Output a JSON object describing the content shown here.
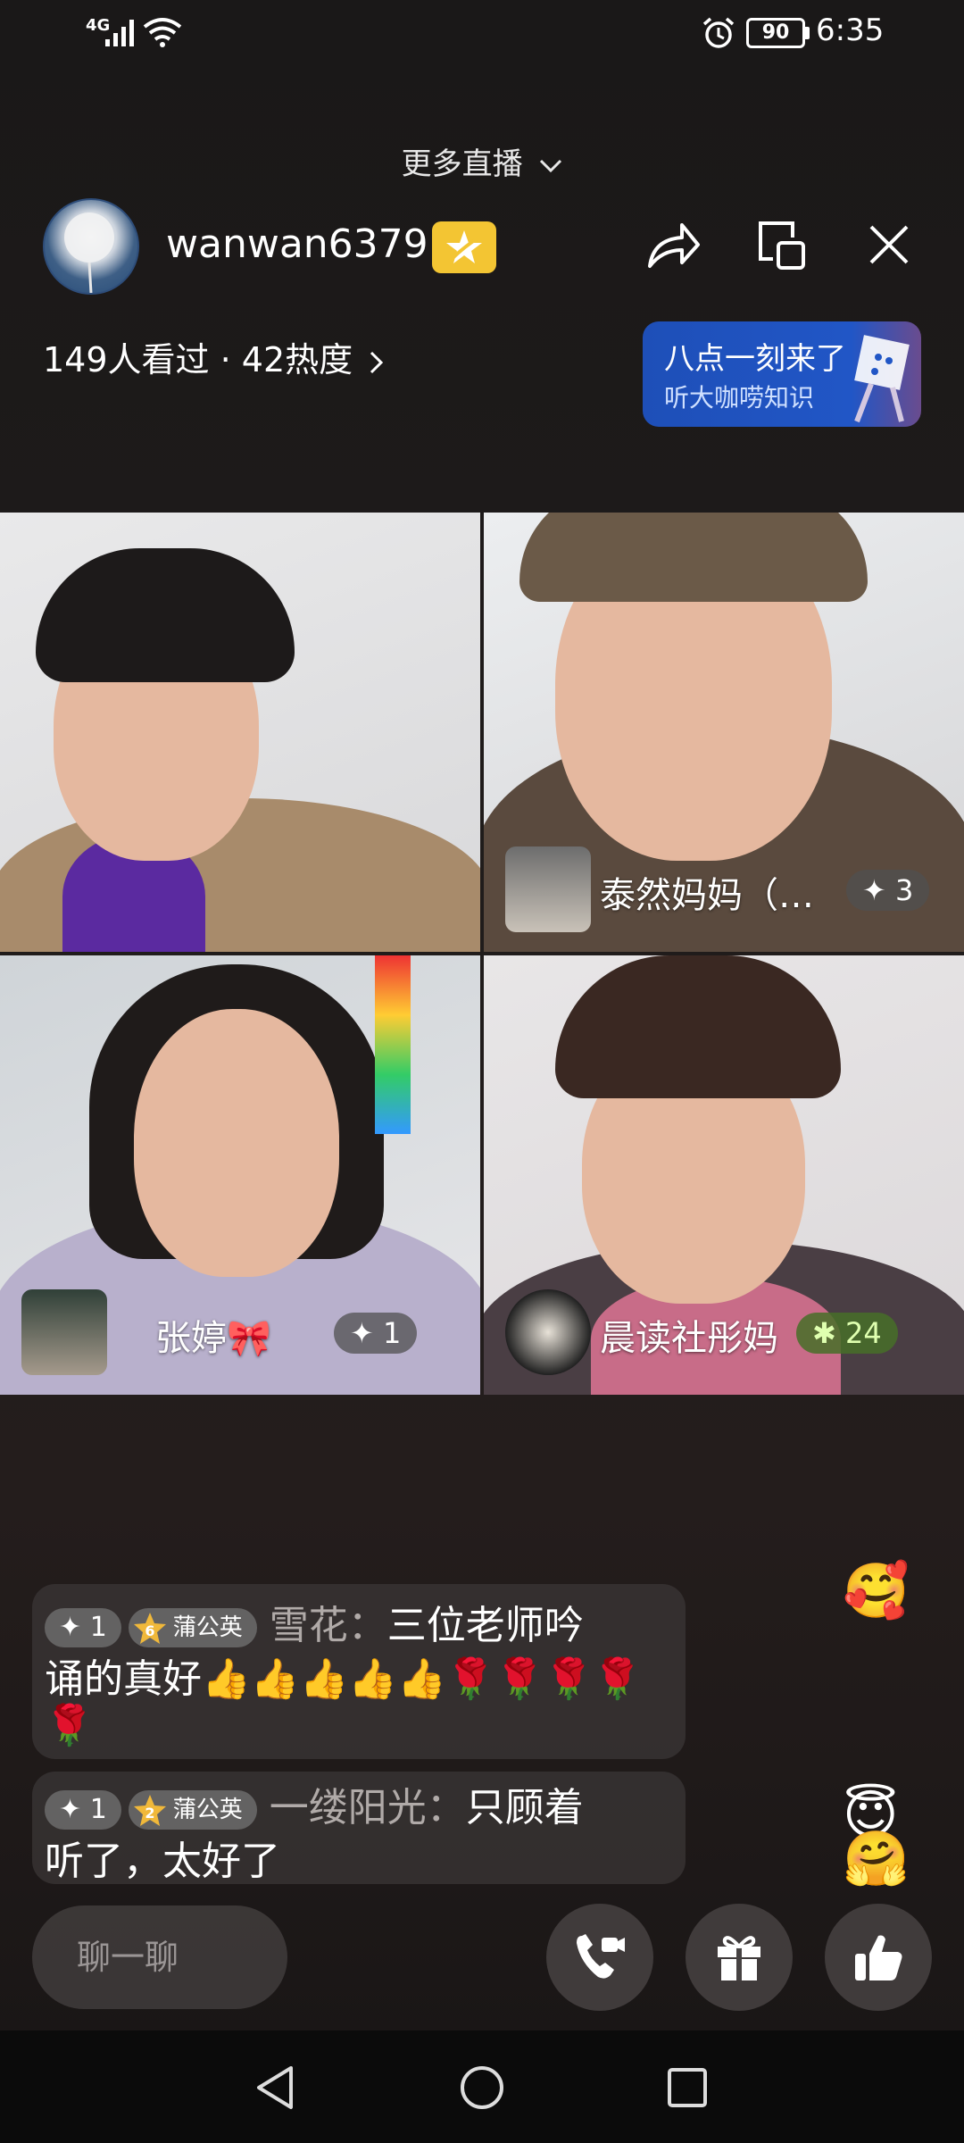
{
  "status_bar": {
    "network": "4G",
    "battery": "90",
    "time": "6:35"
  },
  "header": {
    "more_live": "更多直播",
    "host_name": "wanwan6379",
    "viewers": "149人看过 · 42热度",
    "promo_line1": "八点一刻来了",
    "promo_line2": "听大咖唠知识"
  },
  "video_tiles": [
    {
      "name": ""
    },
    {
      "name": "泰然妈妈（…",
      "likes": "3"
    },
    {
      "name": "张婷🎀",
      "likes": "1"
    },
    {
      "name": "晨读社彤妈",
      "likes": "24"
    }
  ],
  "comments": [
    {
      "badge_num": "1",
      "fan_level": "6",
      "fan_club": "蒲公英",
      "user": "雪花：",
      "text_line1": "三位老师吟",
      "text_line2": "诵的真好👍👍👍👍👍🌹🌹🌹🌹",
      "text_line3": "🌹"
    },
    {
      "badge_num": "1",
      "fan_level": "2",
      "fan_club": "蒲公英",
      "user": "一缕阳光：",
      "text_line1": "只顾着",
      "text_line2": "听了，太好了"
    }
  ],
  "bottom_bar": {
    "chat_placeholder": "聊一聊"
  },
  "icons": {
    "share": "share-icon",
    "pip": "picture-in-picture-icon",
    "close": "close-icon",
    "call": "video-call-icon",
    "gift": "gift-icon",
    "like": "thumbs-up-icon"
  },
  "colors": {
    "host_badge": "#f3c533",
    "promo_bg": "#2156c6",
    "like_pill_green": "#466e28"
  }
}
